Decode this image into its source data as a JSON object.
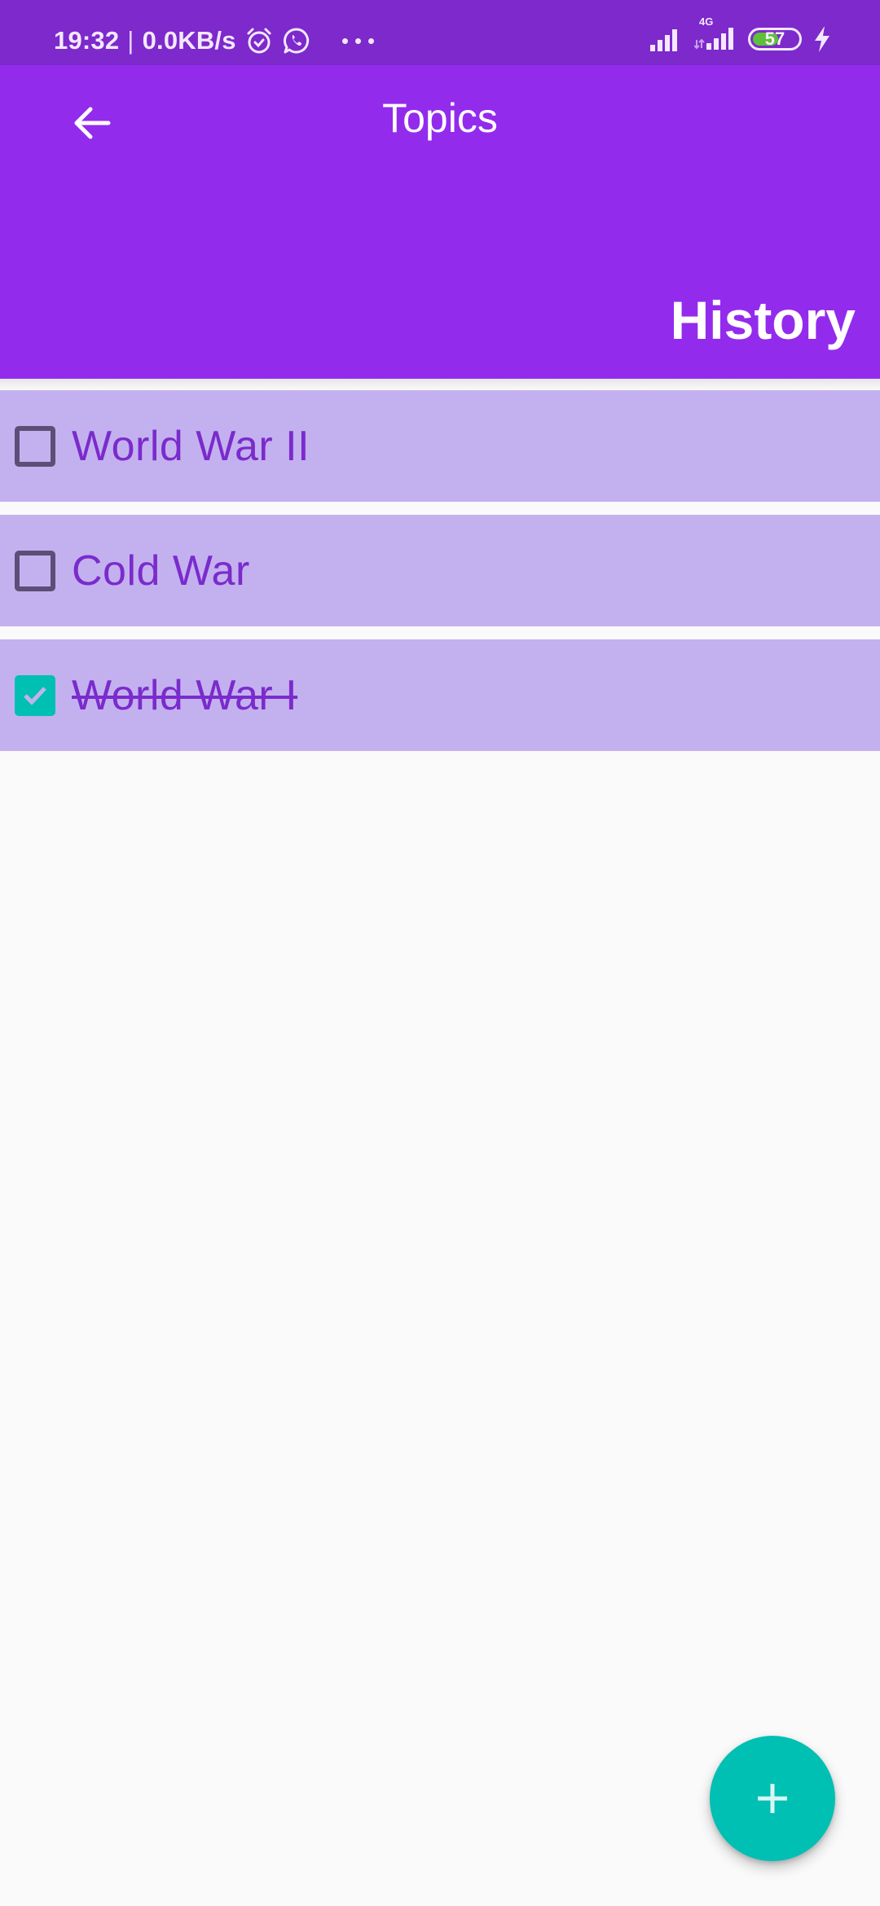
{
  "status_bar": {
    "time": "19:32",
    "separator": "|",
    "network_speed": "0.0KB/s",
    "icons": [
      "alarm-icon",
      "whatsapp-icon",
      "more-dots-icon"
    ],
    "right_icons": [
      "signal-icon",
      "4g-signal-icon",
      "battery-icon",
      "charging-icon"
    ],
    "network_type": "4G",
    "battery_level": "57",
    "battery_percent": 57
  },
  "header": {
    "back_icon": "arrow-left-icon",
    "title": "Topics",
    "category": "History"
  },
  "topics": [
    {
      "label": "World War II",
      "checked": false
    },
    {
      "label": "Cold War",
      "checked": false
    },
    {
      "label": "World War I",
      "checked": true
    }
  ],
  "fab": {
    "icon": "plus-icon",
    "action": "add-topic"
  },
  "colors": {
    "status_bar": "#7d29cc",
    "header": "#932bed",
    "list_item_bg": "#c3b1ef",
    "text_accent": "#7b2bcc",
    "checkbox_border": "#5d4e78",
    "accent_teal": "#00bfb3",
    "background": "#fafafa"
  }
}
